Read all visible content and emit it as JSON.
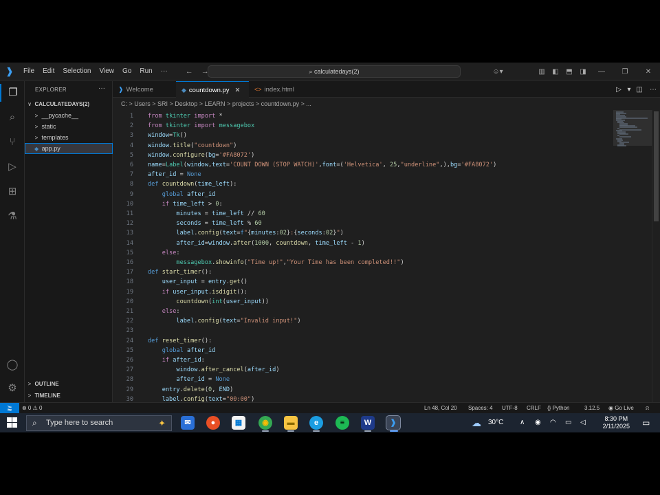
{
  "titlebar": {
    "menu": [
      "File",
      "Edit",
      "Selection",
      "View",
      "Go",
      "Run"
    ],
    "more": "···",
    "back": "←",
    "forward": "→",
    "search": "calculatedays(2)"
  },
  "sidebar": {
    "title": "EXPLORER",
    "more": "···",
    "root": "CALCULATEDAYS(2)",
    "items": [
      {
        "label": "__pycache__",
        "type": "folder"
      },
      {
        "label": "static",
        "type": "folder"
      },
      {
        "label": "templates",
        "type": "folder"
      },
      {
        "label": "app.py",
        "type": "file"
      }
    ],
    "outline": "OUTLINE",
    "timeline": "TIMELINE"
  },
  "tabs": [
    {
      "label": "Welcome",
      "active": false
    },
    {
      "label": "countdown.py",
      "active": true
    },
    {
      "label": "index.html",
      "active": false
    }
  ],
  "breadcrumb": "C: > Users > SRI > Desktop > LEARN > projects > countdown.py > ...",
  "code": [
    {
      "n": "1",
      "html": "<span class='kw2'>from</span> <span class='cls'>tkinter</span> <span class='kw2'>import</span> *"
    },
    {
      "n": "2",
      "html": "<span class='kw2'>from</span> <span class='cls'>tkinter</span> <span class='kw2'>import</span> <span class='cls'>messagebox</span>"
    },
    {
      "n": "3",
      "html": "<span class='var'>window</span>=<span class='cls'>Tk</span>()"
    },
    {
      "n": "4",
      "html": "<span class='var'>window</span>.<span class='fn'>title</span>(<span class='str'>\"countdown\"</span>)"
    },
    {
      "n": "5",
      "html": "<span class='var'>window</span>.<span class='fn'>configure</span>(<span class='var'>bg</span>=<span class='str'>'#FA8072'</span>)"
    },
    {
      "n": "6",
      "html": "<span class='var'>name</span>=<span class='cls'>Label</span>(<span class='var'>window</span>,<span class='var'>text</span>=<span class='str'>'COUNT DOWN (STOP WATCH)'</span>,<span class='var'>font</span>=(<span class='str'>'Helvetica'</span>, <span class='num'>25</span>,<span class='str'>\"underline\"</span>,),<span class='var'>bg</span>=<span class='str'>'#FA8072'</span>)"
    },
    {
      "n": "7",
      "html": "<span class='var'>after_id</span> = <span class='kw'>None</span>"
    },
    {
      "n": "8",
      "html": "<span class='kw'>def</span> <span class='fn'>countdown</span>(<span class='var'>time_left</span>):"
    },
    {
      "n": "9",
      "html": "    <span class='kw'>global</span> <span class='var'>after_id</span>"
    },
    {
      "n": "10",
      "html": "    <span class='kw2'>if</span> <span class='var'>time_left</span> &gt; <span class='num'>0</span>:"
    },
    {
      "n": "11",
      "html": "        <span class='var'>minutes</span> = <span class='var'>time_left</span> // <span class='num'>60</span>"
    },
    {
      "n": "12",
      "html": "        <span class='var'>seconds</span> = <span class='var'>time_left</span> % <span class='num'>60</span>"
    },
    {
      "n": "13",
      "html": "        <span class='var'>label</span>.<span class='fn'>config</span>(<span class='var'>text</span>=<span class='kw'>f</span><span class='str'>\"</span>{<span class='var'>minutes</span>:<span class='num'>02</span>}<span class='str'>:</span>{<span class='var'>seconds</span>:<span class='num'>02</span>}<span class='str'>\"</span>)"
    },
    {
      "n": "14",
      "html": "        <span class='var'>after_id</span>=<span class='var'>window</span>.<span class='fn'>after</span>(<span class='num'>1000</span>, <span class='fn'>countdown</span>, <span class='var'>time_left</span> - <span class='num'>1</span>)"
    },
    {
      "n": "15",
      "html": "    <span class='kw2'>else</span>:"
    },
    {
      "n": "16",
      "html": "        <span class='cls'>messagebox</span>.<span class='fn'>showinfo</span>(<span class='str'>\"Time up!\"</span>,<span class='str'>\"Your Time has been completed!!\"</span>)"
    },
    {
      "n": "17",
      "html": "<span class='kw'>def</span> <span class='fn'>start_timer</span>():"
    },
    {
      "n": "18",
      "html": "    <span class='var'>user_input</span> = <span class='var'>entry</span>.<span class='fn'>get</span>()"
    },
    {
      "n": "19",
      "html": "    <span class='kw2'>if</span> <span class='var'>user_input</span>.<span class='fn'>isdigit</span>():"
    },
    {
      "n": "20",
      "html": "        <span class='fn'>countdown</span>(<span class='cls'>int</span>(<span class='var'>user_input</span>))"
    },
    {
      "n": "21",
      "html": "    <span class='kw2'>else</span>:"
    },
    {
      "n": "22",
      "html": "        <span class='var'>label</span>.<span class='fn'>config</span>(<span class='var'>text</span>=<span class='str'>\"Invalid input!\"</span>)"
    },
    {
      "n": "23",
      "html": ""
    },
    {
      "n": "24",
      "html": "<span class='kw'>def</span> <span class='fn'>reset_timer</span>():"
    },
    {
      "n": "25",
      "html": "    <span class='kw'>global</span> <span class='var'>after_id</span>"
    },
    {
      "n": "26",
      "html": "    <span class='kw2'>if</span> <span class='var'>after_id</span>:"
    },
    {
      "n": "27",
      "html": "        <span class='var'>window</span>.<span class='fn'>after_cancel</span>(<span class='var'>after_id</span>)"
    },
    {
      "n": "28",
      "html": "        <span class='var'>after_id</span> = <span class='kw'>None</span>"
    },
    {
      "n": "29",
      "html": "    <span class='var'>entry</span>.<span class='fn'>delete</span>(<span class='num'>0</span>, <span class='var'>END</span>)"
    },
    {
      "n": "30",
      "html": "    <span class='var'>label</span>.<span class='fn'>config</span>(<span class='var'>text</span>=<span class='str'>\"00:00\"</span>)"
    }
  ],
  "statusbar": {
    "errors": "⊗ 0 ⚠ 0",
    "position": "Ln 48, Col 20",
    "spaces": "Spaces: 4",
    "encoding": "UTF-8",
    "eol": "CRLF",
    "language": "{} Python",
    "version": "3.12.5",
    "golive": "Go Live"
  },
  "taskbar": {
    "search_placeholder": "Type here to search",
    "temperature": "30°C",
    "time": "8:30 PM",
    "date": "2/11/2025"
  },
  "colors": {
    "accent": "#0078d4",
    "editor_bg": "#1f1f1f",
    "taskbar_bg": "#1c2430"
  }
}
